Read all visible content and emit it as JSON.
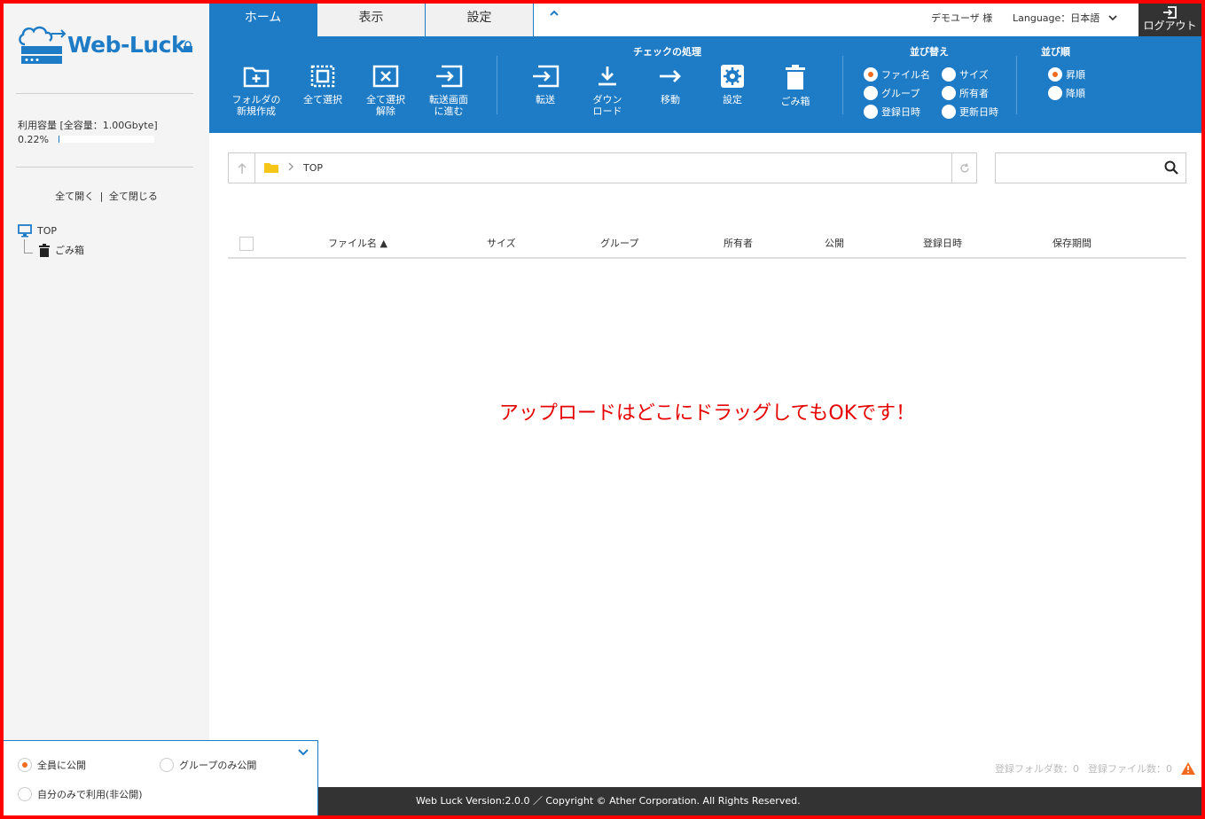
{
  "logo": {
    "text": "Web-Luck"
  },
  "sidebar": {
    "usage_label": "利用容量 [全容量：1.00Gbyte]",
    "usage_percent": "0.22%",
    "usage_fraction": 0.0022,
    "expand_all": "全て開く",
    "divider": "|",
    "collapse_all": "全て閉じる",
    "tree": {
      "top": "TOP",
      "trash": "ごみ箱"
    }
  },
  "publish": {
    "all": "全員に公開",
    "group": "グループのみ公開",
    "self": "自分のみで利用(非公開)"
  },
  "tabs": [
    {
      "label": "ホーム",
      "active": true
    },
    {
      "label": "表示",
      "active": false
    },
    {
      "label": "設定",
      "active": false
    }
  ],
  "header": {
    "user": "デモユーザ 様",
    "language_label": "Language：",
    "language_value": "日本語",
    "logout": "ログアウト"
  },
  "ribbon": {
    "new_folder_1": "フォルダの",
    "new_folder_2": "新規作成",
    "select_all": "全て選択",
    "deselect_1": "全て選択",
    "deselect_2": "解除",
    "goto_transfer_1": "転送画面",
    "goto_transfer_2": "に進む",
    "checked_heading": "チェックの処理",
    "transfer": "転送",
    "download_1": "ダウン",
    "download_2": "ロード",
    "move": "移動",
    "settings": "設定",
    "trash": "ごみ箱",
    "sort_heading": "並び替え",
    "sort_filename": "ファイル名",
    "sort_size": "サイズ",
    "sort_group": "グループ",
    "sort_owner": "所有者",
    "sort_registered": "登録日時",
    "sort_updated": "更新日時",
    "order_heading": "並び順",
    "order_asc": "昇順",
    "order_desc": "降順"
  },
  "path": {
    "current": "TOP"
  },
  "search": {
    "placeholder": ""
  },
  "table": {
    "col_filename": "ファイル名 ▲",
    "col_size": "サイズ",
    "col_group": "グループ",
    "col_owner": "所有者",
    "col_public": "公開",
    "col_registered": "登録日時",
    "col_retention": "保存期間"
  },
  "drop_message": "アップロードはどこにドラッグしてもOKです！",
  "status": {
    "folder_count": "登録フォルダ数：0",
    "file_count": "登録ファイル数：0"
  },
  "footer": {
    "text": "Web Luck Version:2.0.0 ／ Copyright © Ather Corporation. All Rights Reserved."
  },
  "colors": {
    "primary": "#1e7bc6",
    "accent": "#f06a1f",
    "warning": "#e60000"
  }
}
